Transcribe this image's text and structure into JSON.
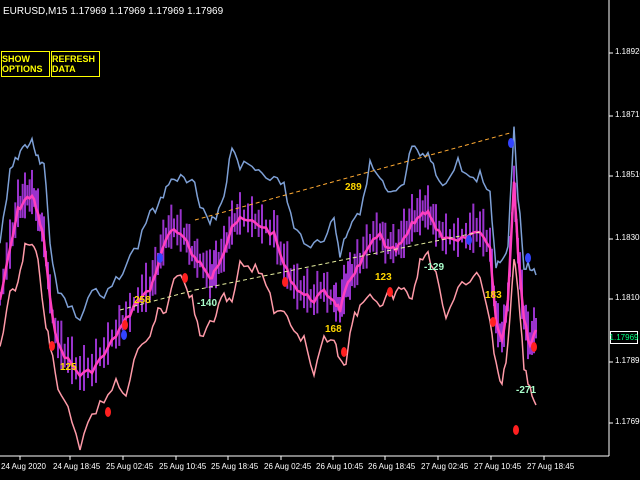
{
  "symbol_info": "EURUSD,M15  1.17969 1.17969 1.17969 1.17969",
  "buttons": {
    "show_options": "SHOW OPTIONS",
    "refresh_data": "REFRESH DATA"
  },
  "price_axis": {
    "labels": [
      "1.18920",
      "1.18715",
      "1.18510",
      "1.18305",
      "1.18100",
      "1.17895",
      "1.17690"
    ],
    "current_price": "1.17969"
  },
  "time_axis": {
    "labels": [
      "24 Aug 2020",
      "24 Aug 18:45",
      "25 Aug 02:45",
      "25 Aug 10:45",
      "25 Aug 18:45",
      "26 Aug 02:45",
      "26 Aug 10:45",
      "26 Aug 18:45",
      "27 Aug 02:45",
      "27 Aug 10:45",
      "27 Aug 18:45"
    ]
  },
  "wave_labels": [
    "125",
    "258",
    "-140",
    "289",
    "168",
    "123",
    "-129",
    "183",
    "-271"
  ],
  "colors": {
    "background": "#000000",
    "button_border": "#ffff00",
    "upper_band": "#7ea0d6",
    "lower_band": "#ff9aa8",
    "main_line": "#ff3fbf",
    "candles": "#9933cc",
    "zigzag_up": "#ffaa33",
    "zigzag_down": "#e8f0a0",
    "label_yellow": "#ffd700",
    "label_green": "#aaffcc",
    "current_price": "#00ff7f"
  }
}
